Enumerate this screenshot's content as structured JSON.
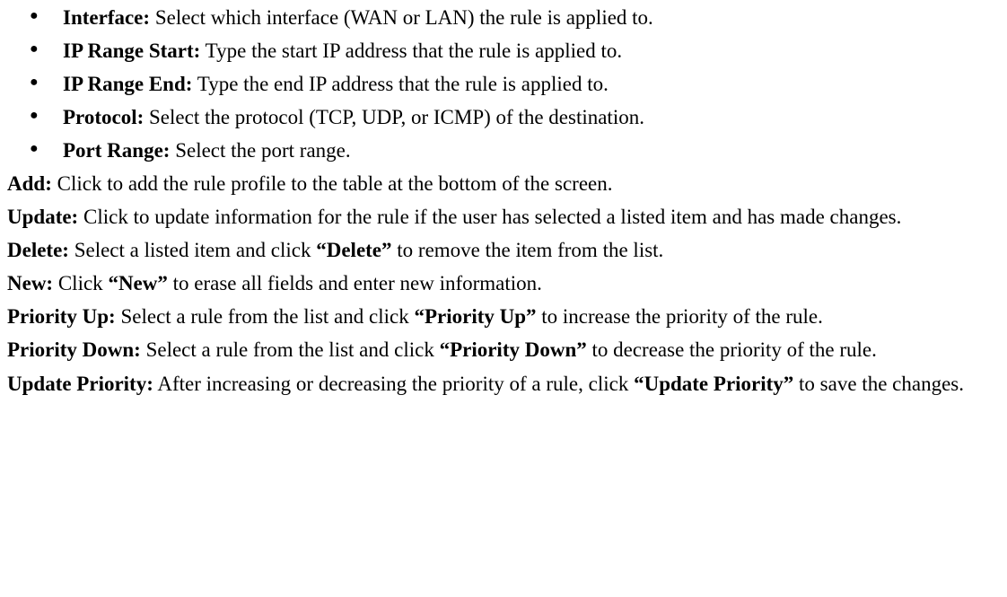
{
  "bullets": [
    {
      "label": "Interface:",
      "desc": " Select which interface (WAN or LAN) the rule is applied to."
    },
    {
      "label": "IP Range Start:",
      "desc": " Type the start IP address that the rule is applied to."
    },
    {
      "label": "IP Range End:",
      "desc": " Type the end IP address that the rule is applied to."
    },
    {
      "label": "Protocol:",
      "desc": " Select the protocol (TCP, UDP, or ICMP) of the destination."
    },
    {
      "label": "Port Range:",
      "desc": " Select the port range."
    }
  ],
  "paragraphs": {
    "add": {
      "label": "Add:",
      "desc": " Click to add the rule profile to the table at the bottom of the screen."
    },
    "update": {
      "label": "Update:",
      "desc": " Click to update information for the rule if the user has selected a listed item and has made changes."
    },
    "delete": {
      "label": "Delete:",
      "pre": " Select a listed item and click ",
      "bold": "“Delete”",
      "post": " to remove the item from the list."
    },
    "new": {
      "label": "New:",
      "pre": " Click ",
      "bold": "“New”",
      "post": " to erase all fields and enter new information."
    },
    "priorityUp": {
      "label": "Priority Up:",
      "pre": " Select a rule from the list and click ",
      "bold": "“Priority Up”",
      "post": " to increase the priority of the rule."
    },
    "priorityDown": {
      "label": "Priority Down:",
      "pre": " Select a rule from the list and click ",
      "bold": "“Priority Down”",
      "post": " to decrease the priority of the rule."
    },
    "updatePriority": {
      "label": "Update Priority:",
      "pre": " After increasing or decreasing the priority of a rule, click ",
      "bold": "“Update Priority”",
      "post": " to save the changes."
    }
  }
}
